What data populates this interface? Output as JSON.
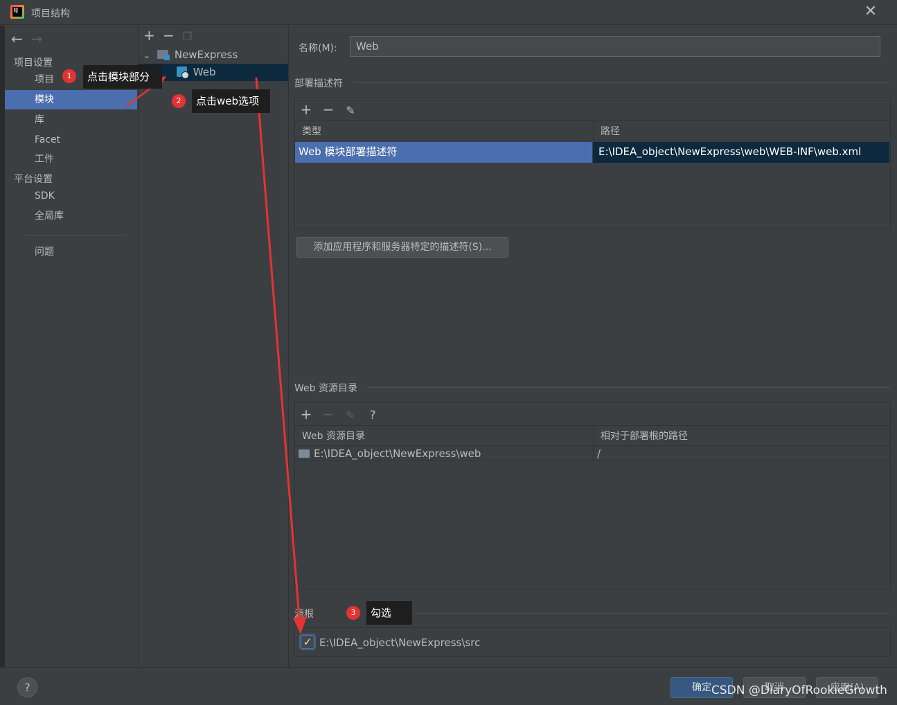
{
  "window": {
    "title": "项目结构",
    "app_icon_text": "IJ"
  },
  "nav": {
    "project_settings": "项目设置",
    "platform_settings": "平台设置",
    "items": [
      {
        "label": "项目"
      },
      {
        "label": "模块"
      },
      {
        "label": "库"
      },
      {
        "label": "Facet"
      },
      {
        "label": "工件"
      }
    ],
    "platform_items": [
      {
        "label": "SDK"
      },
      {
        "label": "全局库"
      }
    ],
    "problems": "问题"
  },
  "tree": {
    "root": "NewExpress",
    "child": "Web"
  },
  "form": {
    "name_label": "名称(M):",
    "name_value": "Web"
  },
  "deployment": {
    "title": "部署描述符",
    "columns": [
      "类型",
      "路径"
    ],
    "rows": [
      {
        "type": "Web 模块部署描述符",
        "path": "E:\\IDEA_object\\NewExpress\\web\\WEB-INF\\web.xml"
      }
    ],
    "add_button": "添加应用程序和服务器特定的描述符(S)..."
  },
  "web_resources": {
    "title": "Web 资源目录",
    "columns": [
      "Web 资源目录",
      "相对于部署根的路径"
    ],
    "rows": [
      {
        "dir": "E:\\IDEA_object\\NewExpress\\web",
        "relative": "/"
      }
    ]
  },
  "source_roots": {
    "title": "源根",
    "items": [
      {
        "path": "E:\\IDEA_object\\NewExpress\\src",
        "checked": true
      }
    ]
  },
  "buttons": {
    "ok": "确定",
    "cancel": "取消",
    "apply": "应用(A)",
    "help": "?"
  },
  "annotations": [
    {
      "number": "1",
      "text": "点击模块部分"
    },
    {
      "number": "2",
      "text": "点击web选项"
    },
    {
      "number": "3",
      "text": "勾选"
    }
  ],
  "watermark": "CSDN @DiaryOfRookieGrowth",
  "colors": {
    "selection": "#4b6eaf",
    "background": "#3c3f41",
    "annotation_red": "#e53333"
  }
}
